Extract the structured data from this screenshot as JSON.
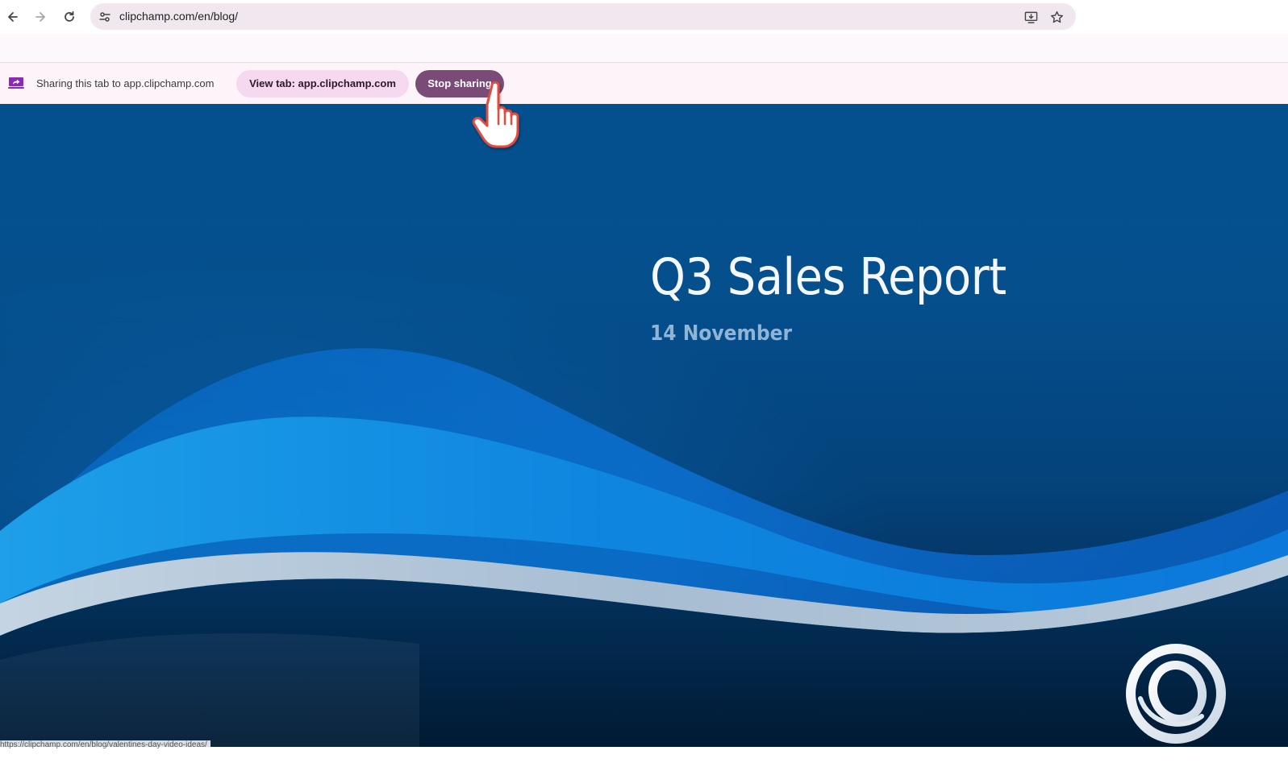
{
  "browser": {
    "url": "clipchamp.com/en/blog/",
    "back_icon": "arrow-left-icon",
    "forward_icon": "arrow-right-icon",
    "reload_icon": "reload-icon",
    "site_info_icon": "tune-icon",
    "install_icon": "install-app-icon",
    "bookmark_icon": "star-icon"
  },
  "infobar": {
    "icon": "screen-share-icon",
    "message": "Sharing this tab to app.clipchamp.com",
    "view_tab_label": "View tab: app.clipchamp.com",
    "stop_sharing_label": "Stop sharing"
  },
  "slide": {
    "title": "Q3 Sales Report",
    "subtitle": "14 November",
    "logo_icon": "ring-logo-icon"
  },
  "status": {
    "hover_url": "https://clipchamp.com/en/blog/valentines-day-video-ideas/"
  },
  "colors": {
    "accent": "#7a4b76",
    "pill_light": "#f6d8ef",
    "omnibox": "#f1e8ef",
    "slide_blue": "#04508f"
  }
}
